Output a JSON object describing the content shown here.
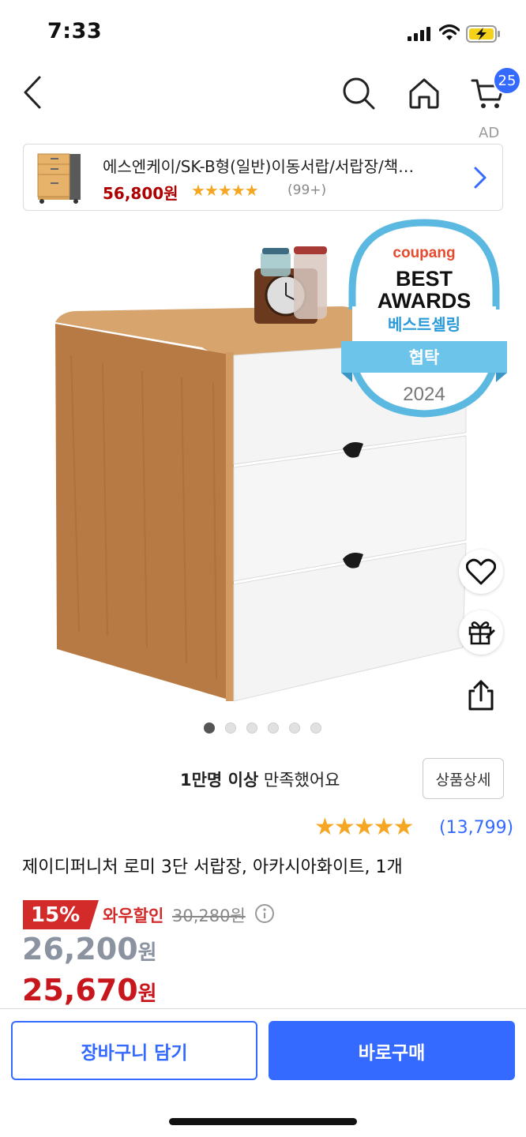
{
  "status_bar": {
    "time": "7:33"
  },
  "nav": {
    "cart_count": "25"
  },
  "ad": {
    "label": "AD",
    "title": "에스엔케이/SK-B형(일반)이동서랍/서랍장/책…",
    "price": "56,800원",
    "stars": "★★★★★",
    "review_count": "(99+)",
    "rating_fraction": 0.9
  },
  "award": {
    "brand": "coupang",
    "line1": "BEST",
    "line2": "AWARDS",
    "category": "베스트셀링",
    "ribbon": "협탁",
    "year": "2024"
  },
  "gallery": {
    "count": 6,
    "active_index": 0
  },
  "satisfaction": {
    "bold": "1만명 이상",
    "rest": " 만족했어요",
    "detail_button": "상품상세"
  },
  "rating": {
    "stars": "★★★★★",
    "fraction": 0.9,
    "count": "(13,799)"
  },
  "product": {
    "name": "제이디퍼니처 로미 3단 서랍장, 아카시아화이트, 1개"
  },
  "pricing": {
    "discount": "15%",
    "wow_label": "와우할인",
    "original": "30,280원",
    "price_amount": "26,200",
    "price_unit": "원",
    "wow_amount": "25,670",
    "wow_unit": "원"
  },
  "actions": {
    "add_to_cart": "장바구니 담기",
    "buy_now": "바로구매"
  },
  "colors": {
    "accent": "#346aff",
    "sale_red": "#d32a2a",
    "star": "#f5a623"
  }
}
